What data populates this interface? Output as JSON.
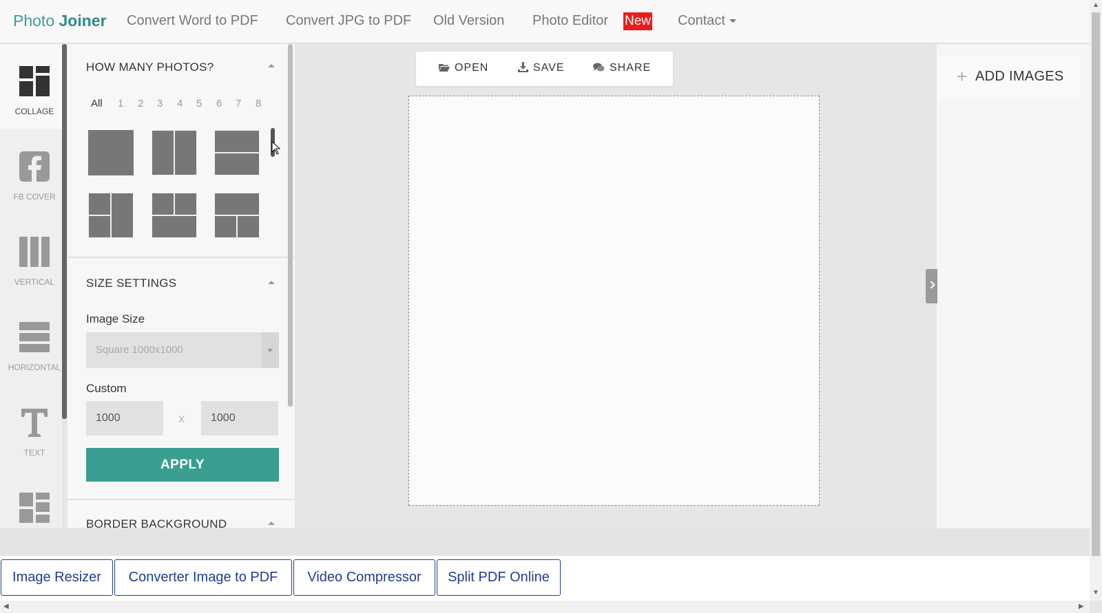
{
  "nav": {
    "brand_part1": "Photo",
    "brand_part2": "Joiner",
    "links": [
      "Convert Word to PDF",
      "Convert JPG to PDF",
      "Old Version",
      "Photo Editor",
      "Contact"
    ],
    "new_badge": "New"
  },
  "iconbar": {
    "items": [
      {
        "label": "COLLAGE",
        "icon": "collage-icon"
      },
      {
        "label": "FB COVER",
        "icon": "facebook-icon"
      },
      {
        "label": "VERTICAL",
        "icon": "vertical-layout-icon"
      },
      {
        "label": "HORIZONTAL",
        "icon": "horizontal-layout-icon"
      },
      {
        "label": "TEXT",
        "icon": "text-icon"
      },
      {
        "label": "",
        "icon": "templates-icon"
      }
    ]
  },
  "panel": {
    "how_many_title": "HOW MANY PHOTOS?",
    "count_tabs": [
      "All",
      "1",
      "2",
      "3",
      "4",
      "5",
      "6",
      "7",
      "8"
    ],
    "size_title": "SIZE SETTINGS",
    "image_size_label": "Image Size",
    "image_size_value": "Square 1000x1000",
    "custom_label": "Custom",
    "width_value": "1000",
    "height_value": "1000",
    "times_symbol": "X",
    "apply_label": "APPLY",
    "border_title": "BORDER BACKGROUND"
  },
  "toolbar": {
    "open": "OPEN",
    "save": "SAVE",
    "share": "SHARE"
  },
  "right": {
    "add_images": "ADD IMAGES"
  },
  "footer": {
    "buttons": [
      "Image Resizer",
      "Converter Image to PDF",
      "Video Compressor",
      "Split PDF Online"
    ]
  },
  "colors": {
    "brand": "#3a9e98",
    "accent": "#3a9e90",
    "badge": "#e81d1d",
    "footer_link": "#1e3d8f"
  }
}
